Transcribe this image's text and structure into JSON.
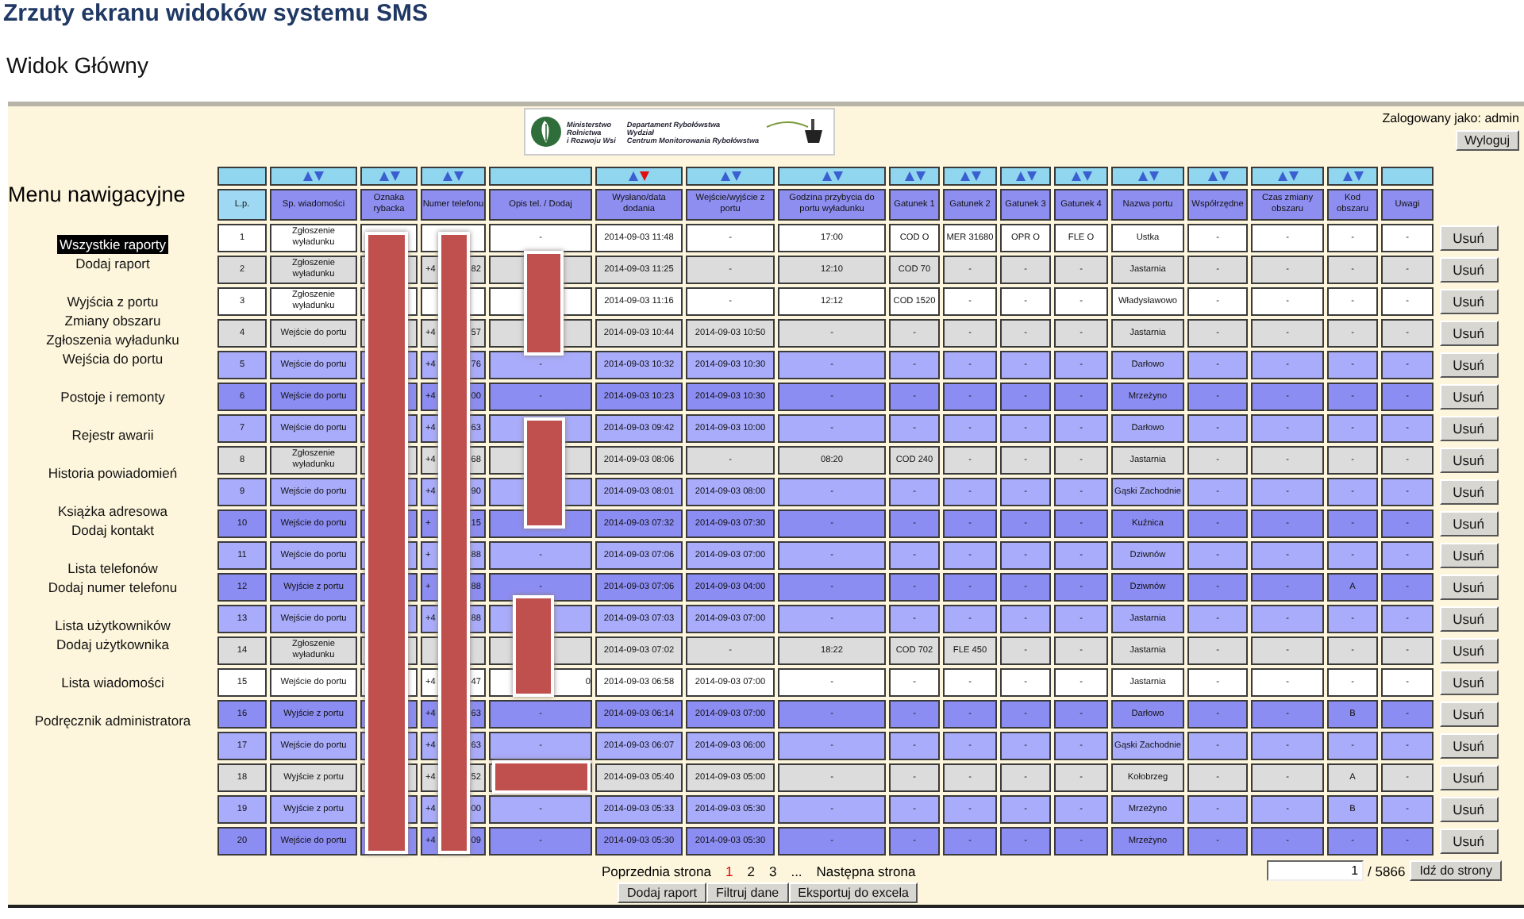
{
  "document": {
    "title": "Zrzuty ekranu widoków systemu SMS",
    "subtitle": "Widok Główny"
  },
  "logo": {
    "ministry": [
      "Ministerstwo",
      "Rolnictwa",
      "i Rozwoju Wsi"
    ],
    "department": [
      "Departament Rybołówstwa",
      "Wydział",
      "Centrum Monitorowania Rybołówstwa"
    ]
  },
  "user": {
    "label": "Zalogowany jako: admin",
    "logout": "Wyloguj"
  },
  "menu": {
    "title": "Menu nawigacyjne",
    "groups": [
      [
        {
          "label": "Wszystkie raporty",
          "selected": true
        },
        {
          "label": "Dodaj raport",
          "selected": false
        }
      ],
      [
        {
          "label": "Wyjścia z portu",
          "selected": false
        },
        {
          "label": "Zmiany obszaru",
          "selected": false
        },
        {
          "label": "Zgłoszenia wyładunku",
          "selected": false
        },
        {
          "label": "Wejścia do portu",
          "selected": false
        }
      ],
      [
        {
          "label": "Postoje i remonty",
          "selected": false
        }
      ],
      [
        {
          "label": "Rejestr awarii",
          "selected": false
        }
      ],
      [
        {
          "label": "Historia powiadomień",
          "selected": false
        }
      ],
      [
        {
          "label": "Książka adresowa",
          "selected": false
        },
        {
          "label": "Dodaj kontakt",
          "selected": false
        }
      ],
      [
        {
          "label": "Lista telefonów",
          "selected": false
        },
        {
          "label": "Dodaj numer telefonu",
          "selected": false
        }
      ],
      [
        {
          "label": "Lista użytkowników",
          "selected": false
        },
        {
          "label": "Dodaj użytkownika",
          "selected": false
        }
      ],
      [
        {
          "label": "Lista wiadomości",
          "selected": false
        }
      ],
      [
        {
          "label": "Podręcznik administratora",
          "selected": false
        }
      ]
    ]
  },
  "table": {
    "columns": [
      {
        "label": "L.p.",
        "sortable": false
      },
      {
        "label": "Sp. wiadomości",
        "sortable": true,
        "sorted_descending": false
      },
      {
        "label": "Oznaka rybacka",
        "sortable": true,
        "sorted_descending": false
      },
      {
        "label": "Numer telefonu",
        "sortable": true,
        "sorted_descending": false
      },
      {
        "label": "Opis tel. / Dodaj",
        "sortable": false
      },
      {
        "label": "Wysłano/data dodania",
        "sortable": true,
        "sorted_descending": true
      },
      {
        "label": "Wejście/wyjście z portu",
        "sortable": true,
        "sorted_descending": false
      },
      {
        "label": "Godzina przybycia do portu wyładunku",
        "sortable": true,
        "sorted_descending": false
      },
      {
        "label": "Gatunek 1",
        "sortable": true,
        "sorted_descending": false
      },
      {
        "label": "Gatunek 2",
        "sortable": true,
        "sorted_descending": false
      },
      {
        "label": "Gatunek 3",
        "sortable": true,
        "sorted_descending": false
      },
      {
        "label": "Gatunek 4",
        "sortable": true,
        "sorted_descending": false
      },
      {
        "label": "Nazwa portu",
        "sortable": true,
        "sorted_descending": false
      },
      {
        "label": "Współrzędne",
        "sortable": true,
        "sorted_descending": false
      },
      {
        "label": "Czas zmiany obszaru",
        "sortable": true,
        "sorted_descending": false
      },
      {
        "label": "Kod obszaru",
        "sortable": true,
        "sorted_descending": false
      },
      {
        "label": "Uwagi",
        "sortable": false
      }
    ],
    "rows": [
      {
        "lp": "1",
        "type": "Zgłoszenie wyładunku",
        "description": "-",
        "sent": "2014-09-03 11:48",
        "port_time": "-",
        "arrival": "17:00",
        "species": [
          "COD O",
          "MER 31680",
          "OPR O",
          "FLE O"
        ],
        "port": "Ustka",
        "coords": "-",
        "area_change": "-",
        "area_code": "-",
        "notes": "-",
        "color": "#ffffff",
        "action": "Usuń"
      },
      {
        "lp": "2",
        "type": "Zgłoszenie wyładunku",
        "phone_start": "+4",
        "phone_end": "82",
        "sent": "2014-09-03 11:25",
        "port_time": "-",
        "arrival": "12:10",
        "species": [
          "COD 70",
          "-",
          "-",
          "-"
        ],
        "port": "Jastarnia",
        "coords": "-",
        "area_change": "-",
        "area_code": "-",
        "notes": "-",
        "color": "#dcdcdc",
        "action": "Usuń"
      },
      {
        "lp": "3",
        "type": "Zgłoszenie wyładunku",
        "sent": "2014-09-03 11:16",
        "port_time": "-",
        "arrival": "12:12",
        "species": [
          "COD 1520",
          "-",
          "-",
          "-"
        ],
        "port": "Władysławowo",
        "coords": "-",
        "area_change": "-",
        "area_code": "-",
        "notes": "-",
        "color": "#ffffff",
        "action": "Usuń"
      },
      {
        "lp": "4",
        "type": "Wejście do portu",
        "phone_start": "+4",
        "phone_end": "57",
        "sent": "2014-09-03 10:44",
        "port_time": "2014-09-03 10:50",
        "arrival": "-",
        "species": [
          "-",
          "-",
          "-",
          "-"
        ],
        "port": "Jastarnia",
        "coords": "-",
        "area_change": "-",
        "area_code": "-",
        "notes": "-",
        "color": "#dcdcdc",
        "action": "Usuń"
      },
      {
        "lp": "5",
        "type": "Wejście do portu",
        "phone_start": "+4",
        "phone_end": "76",
        "description": "-",
        "sent": "2014-09-03 10:32",
        "port_time": "2014-09-03 10:30",
        "arrival": "-",
        "species": [
          "-",
          "-",
          "-",
          "-"
        ],
        "port": "Darłowo",
        "coords": "-",
        "area_change": "-",
        "area_code": "-",
        "notes": "-",
        "color": "#a9acfa",
        "action": "Usuń"
      },
      {
        "lp": "6",
        "type": "Wejście do portu",
        "phone_start": "+4",
        "phone_end": "00",
        "description": "-",
        "sent": "2014-09-03 10:23",
        "port_time": "2014-09-03 10:30",
        "arrival": "-",
        "species": [
          "-",
          "-",
          "-",
          "-"
        ],
        "port": "Mrzeżyno",
        "coords": "-",
        "area_change": "-",
        "area_code": "-",
        "notes": "-",
        "color": "#8c8df2",
        "action": "Usuń"
      },
      {
        "lp": "7",
        "type": "Wejście do portu",
        "phone_start": "+4",
        "phone_end": "63",
        "sent": "2014-09-03 09:42",
        "port_time": "2014-09-03 10:00",
        "arrival": "-",
        "species": [
          "-",
          "-",
          "-",
          "-"
        ],
        "port": "Darłowo",
        "coords": "-",
        "area_change": "-",
        "area_code": "-",
        "notes": "-",
        "color": "#a9acfa",
        "action": "Usuń"
      },
      {
        "lp": "8",
        "type": "Zgłoszenie wyładunku",
        "phone_start": "+4",
        "phone_end": "68",
        "sent": "2014-09-03 08:06",
        "port_time": "-",
        "arrival": "08:20",
        "species": [
          "COD 240",
          "-",
          "-",
          "-"
        ],
        "port": "Jastarnia",
        "coords": "-",
        "area_change": "-",
        "area_code": "-",
        "notes": "-",
        "color": "#dcdcdc",
        "action": "Usuń"
      },
      {
        "lp": "9",
        "type": "Wejście do portu",
        "phone_start": "+4",
        "phone_end": "90",
        "sent": "2014-09-03 08:01",
        "port_time": "2014-09-03 08:00",
        "arrival": "-",
        "species": [
          "-",
          "-",
          "-",
          "-"
        ],
        "port": "Gąski Zachodnie",
        "coords": "-",
        "area_change": "-",
        "area_code": "-",
        "notes": "-",
        "color": "#a9acfa",
        "action": "Usuń"
      },
      {
        "lp": "10",
        "type": "Wejście do portu",
        "phone_start": "+",
        "phone_end": "15",
        "sent": "2014-09-03 07:32",
        "port_time": "2014-09-03 07:30",
        "arrival": "-",
        "species": [
          "-",
          "-",
          "-",
          "-"
        ],
        "port": "Kuźnica",
        "coords": "-",
        "area_change": "-",
        "area_code": "-",
        "notes": "-",
        "color": "#8c8df2",
        "action": "Usuń"
      },
      {
        "lp": "11",
        "type": "Wejście do portu",
        "phone_start": "+",
        "phone_end": "88",
        "description": "-",
        "sent": "2014-09-03 07:06",
        "port_time": "2014-09-03 07:00",
        "arrival": "-",
        "species": [
          "-",
          "-",
          "-",
          "-"
        ],
        "port": "Dziwnów",
        "coords": "-",
        "area_change": "-",
        "area_code": "-",
        "notes": "-",
        "color": "#a9acfa",
        "action": "Usuń"
      },
      {
        "lp": "12",
        "type": "Wyjście z portu",
        "phone_start": "+",
        "phone_end": "88",
        "description": "-",
        "sent": "2014-09-03 07:06",
        "port_time": "2014-09-03 04:00",
        "arrival": "-",
        "species": [
          "-",
          "-",
          "-",
          "-"
        ],
        "port": "Dziwnów",
        "coords": "-",
        "area_change": "-",
        "area_code": "A",
        "notes": "-",
        "color": "#8c8df2",
        "action": "Usuń"
      },
      {
        "lp": "13",
        "type": "Wejście do portu",
        "phone_start": "+4",
        "phone_end": "88",
        "sent": "2014-09-03 07:03",
        "port_time": "2014-09-03 07:00",
        "arrival": "-",
        "species": [
          "-",
          "-",
          "-",
          "-"
        ],
        "port": "Jastarnia",
        "coords": "-",
        "area_change": "-",
        "area_code": "-",
        "notes": "-",
        "color": "#a9acfa",
        "action": "Usuń"
      },
      {
        "lp": "14",
        "type": "Zgłoszenie wyładunku",
        "sent": "2014-09-03 07:02",
        "port_time": "-",
        "arrival": "18:22",
        "species": [
          "COD 702",
          "FLE 450",
          "-",
          "-"
        ],
        "port": "Jastarnia",
        "coords": "-",
        "area_change": "-",
        "area_code": "-",
        "notes": "-",
        "color": "#dcdcdc",
        "action": "Usuń"
      },
      {
        "lp": "15",
        "type": "Wejście do portu",
        "phone_start": "+4",
        "phone_end": "47",
        "description": "0",
        "sent": "2014-09-03 06:58",
        "port_time": "2014-09-03 07:00",
        "arrival": "-",
        "species": [
          "-",
          "-",
          "-",
          "-"
        ],
        "port": "Jastarnia",
        "coords": "-",
        "area_change": "-",
        "area_code": "-",
        "notes": "-",
        "color": "#ffffff",
        "action": "Usuń"
      },
      {
        "lp": "16",
        "type": "Wyjście z portu",
        "phone_start": "+4",
        "phone_end": "63",
        "description": "-",
        "sent": "2014-09-03 06:14",
        "port_time": "2014-09-03 07:00",
        "arrival": "-",
        "species": [
          "-",
          "-",
          "-",
          "-"
        ],
        "port": "Darłowo",
        "coords": "-",
        "area_change": "-",
        "area_code": "B",
        "notes": "-",
        "color": "#8c8df2",
        "action": "Usuń"
      },
      {
        "lp": "17",
        "type": "Wejście do portu",
        "phone_start": "+4",
        "phone_end": "63",
        "description": "-",
        "sent": "2014-09-03 06:07",
        "port_time": "2014-09-03 06:00",
        "arrival": "-",
        "species": [
          "-",
          "-",
          "-",
          "-"
        ],
        "port": "Gąski Zachodnie",
        "coords": "-",
        "area_change": "-",
        "area_code": "-",
        "notes": "-",
        "color": "#a9acfa",
        "action": "Usuń"
      },
      {
        "lp": "18",
        "type": "Wyjście z portu",
        "phone_start": "+4",
        "phone_end": "52",
        "sent": "2014-09-03 05:40",
        "port_time": "2014-09-03 05:00",
        "arrival": "-",
        "species": [
          "-",
          "-",
          "-",
          "-"
        ],
        "port": "Kołobrzeg",
        "coords": "-",
        "area_change": "-",
        "area_code": "A",
        "notes": "-",
        "color": "#dcdcdc",
        "action": "Usuń"
      },
      {
        "lp": "19",
        "type": "Wyjście z portu",
        "phone_start": "+4",
        "phone_end": "00",
        "description": "-",
        "sent": "2014-09-03 05:33",
        "port_time": "2014-09-03 05:30",
        "arrival": "-",
        "species": [
          "-",
          "-",
          "-",
          "-"
        ],
        "port": "Mrzeżyno",
        "coords": "-",
        "area_change": "-",
        "area_code": "B",
        "notes": "-",
        "color": "#a9acfa",
        "action": "Usuń"
      },
      {
        "lp": "20",
        "type": "Wejście do portu",
        "phone_start": "+4",
        "phone_end": "09",
        "description": "-",
        "sent": "2014-09-03 05:30",
        "port_time": "2014-09-03 05:30",
        "arrival": "-",
        "species": [
          "-",
          "-",
          "-",
          "-"
        ],
        "port": "Mrzeżyno",
        "coords": "-",
        "area_change": "-",
        "area_code": "-",
        "notes": "-",
        "color": "#8c8df2",
        "action": "Usuń"
      }
    ]
  },
  "pagination": {
    "previous": "Poprzednia strona",
    "pages": [
      {
        "label": "1",
        "selected": true
      },
      {
        "label": "2",
        "selected": false
      },
      {
        "label": "3",
        "selected": false
      }
    ],
    "ellipsis": "...",
    "next": "Następna strona",
    "page_input": "1",
    "total": "/ 5866",
    "go": "Idź do strony"
  },
  "buttons": [
    "Dodaj raport",
    "Filtruj dane",
    "Eksportuj do excela"
  ]
}
